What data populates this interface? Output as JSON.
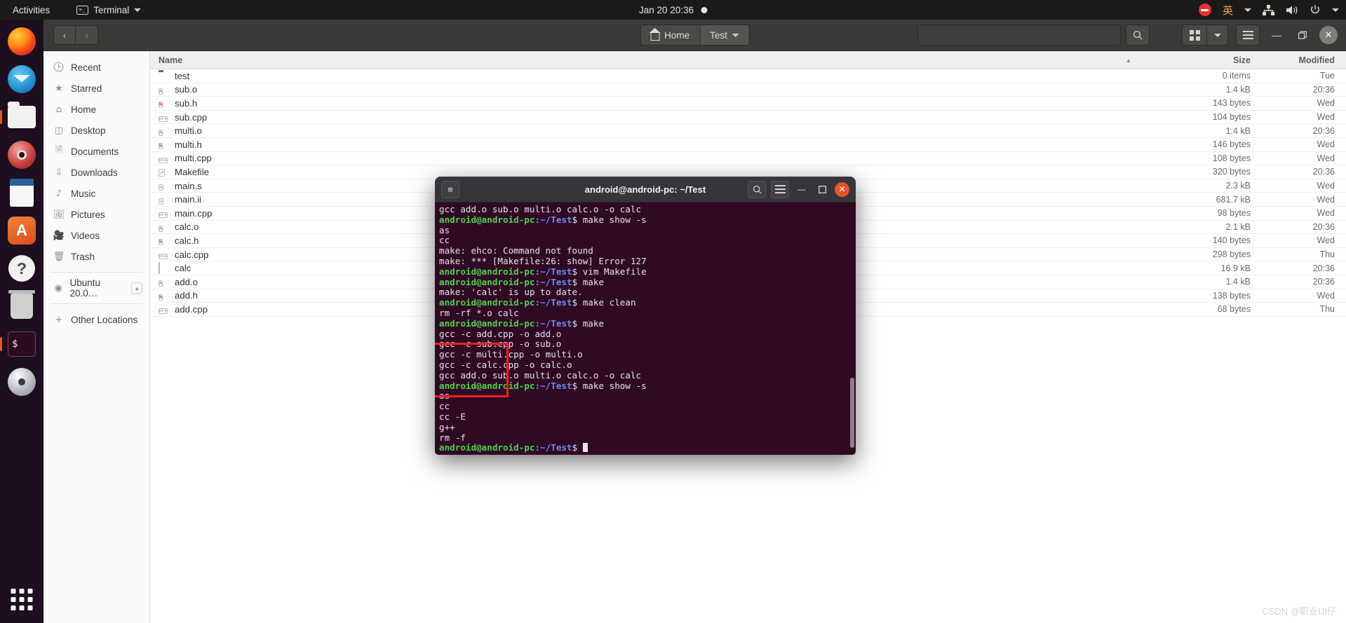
{
  "topbar": {
    "activities": "Activities",
    "app_menu": "Terminal",
    "app_icon": "terminal-icon",
    "clock": "Jan 20  20:36",
    "recording_dot": "recording-indicator",
    "tray": {
      "dnd_icon": "do-not-disturb-icon",
      "input_method": "英",
      "network_icon": "network-icon",
      "volume_icon": "volume-icon",
      "power_icon": "power-icon"
    }
  },
  "dock": {
    "items": [
      {
        "name": "firefox",
        "label": "Firefox"
      },
      {
        "name": "thunderbird",
        "label": "Thunderbird Mail"
      },
      {
        "name": "files",
        "label": "Files"
      },
      {
        "name": "rhythmbox",
        "label": "Rhythmbox"
      },
      {
        "name": "libreoffice-writer",
        "label": "LibreOffice Writer"
      },
      {
        "name": "ubuntu-software",
        "label": "Ubuntu Software"
      },
      {
        "name": "help",
        "label": "Help"
      },
      {
        "name": "trash",
        "label": "Trash"
      },
      {
        "name": "terminal",
        "label": "Terminal"
      },
      {
        "name": "dvd",
        "label": "Ubuntu 20.0 Disc"
      }
    ],
    "show_apps": "Show Applications"
  },
  "nautilus": {
    "nav": {
      "back": "‹",
      "forward": "›"
    },
    "breadcrumbs": [
      {
        "label": "Home",
        "icon": "home-icon"
      },
      {
        "label": "Test",
        "icon": "chevron-down-icon"
      }
    ],
    "search": {
      "placeholder": "",
      "value": "",
      "icon": "search-icon"
    },
    "view_toggle": {
      "icon": "grid-view-icon",
      "caret": "chevron-down-icon"
    },
    "menu_icon": "hamburger-menu-icon",
    "window_controls": {
      "minimize": "—",
      "maximize": "❐",
      "close": "✕"
    },
    "sidebar": [
      {
        "label": "Recent",
        "icon": "clock-icon"
      },
      {
        "label": "Starred",
        "icon": "star-icon"
      },
      {
        "label": "Home",
        "icon": "home-icon"
      },
      {
        "label": "Desktop",
        "icon": "desktop-icon"
      },
      {
        "label": "Documents",
        "icon": "documents-icon"
      },
      {
        "label": "Downloads",
        "icon": "downloads-icon"
      },
      {
        "label": "Music",
        "icon": "music-icon"
      },
      {
        "label": "Pictures",
        "icon": "pictures-icon"
      },
      {
        "label": "Videos",
        "icon": "videos-icon"
      },
      {
        "label": "Trash",
        "icon": "trash-icon"
      }
    ],
    "sidebar_devices": [
      {
        "label": "Ubuntu 20.0…",
        "icon": "disc-icon",
        "eject": "eject-icon"
      }
    ],
    "sidebar_other": {
      "label": "Other Locations",
      "icon": "plus-icon"
    },
    "columns": {
      "name": "Name",
      "size": "Size",
      "modified": "Modified",
      "sort_indicator": "▲"
    },
    "files": [
      {
        "name": "test",
        "icon": "folder",
        "size": "0 items",
        "modified": "Tue"
      },
      {
        "name": "sub.o",
        "icon": "obj",
        "size": "1.4 kB",
        "modified": "20:36"
      },
      {
        "name": "sub.h",
        "icon": "header",
        "size": "143 bytes",
        "modified": "Wed"
      },
      {
        "name": "sub.cpp",
        "icon": "cpp",
        "size": "104 bytes",
        "modified": "Wed"
      },
      {
        "name": "multi.o",
        "icon": "obj",
        "size": "1.4 kB",
        "modified": "20:36"
      },
      {
        "name": "multi.h",
        "icon": "header",
        "size": "146 bytes",
        "modified": "Wed"
      },
      {
        "name": "multi.cpp",
        "icon": "cpp",
        "size": "108 bytes",
        "modified": "Wed"
      },
      {
        "name": "Makefile",
        "icon": "makefile",
        "size": "320 bytes",
        "modified": "20:36"
      },
      {
        "name": "main.s",
        "icon": "text",
        "size": "2.3 kB",
        "modified": "Wed"
      },
      {
        "name": "main.ii",
        "icon": "text",
        "size": "681.7 kB",
        "modified": "Wed"
      },
      {
        "name": "main.cpp",
        "icon": "cpp",
        "size": "98 bytes",
        "modified": "Wed"
      },
      {
        "name": "calc.o",
        "icon": "obj",
        "size": "2.1 kB",
        "modified": "20:36"
      },
      {
        "name": "calc.h",
        "icon": "header",
        "size": "140 bytes",
        "modified": "Wed"
      },
      {
        "name": "calc.cpp",
        "icon": "cpp",
        "size": "298 bytes",
        "modified": "Thu"
      },
      {
        "name": "calc",
        "icon": "exec",
        "size": "16.9 kB",
        "modified": "20:36"
      },
      {
        "name": "add.o",
        "icon": "obj",
        "size": "1.4 kB",
        "modified": "20:36"
      },
      {
        "name": "add.h",
        "icon": "header",
        "size": "138 bytes",
        "modified": "Wed"
      },
      {
        "name": "add.cpp",
        "icon": "cpp",
        "size": "68 bytes",
        "modified": "Thu"
      }
    ]
  },
  "terminal": {
    "title": "android@android-pc: ~/Test",
    "new_tab_icon": "new-tab-icon",
    "search_icon": "search-icon",
    "menu_icon": "hamburger-menu-icon",
    "minimize": "—",
    "maximize": "❐",
    "close": "✕",
    "prompt_user": "android@android-pc",
    "prompt_path": ":~/Test",
    "prompt_sigil": "$ ",
    "lines": [
      {
        "type": "out",
        "text": "gcc add.o sub.o multi.o calc.o -o calc"
      },
      {
        "type": "cmd",
        "text": "make show -s"
      },
      {
        "type": "out",
        "text": "as"
      },
      {
        "type": "out",
        "text": "cc"
      },
      {
        "type": "out",
        "text": "make: ehco: Command not found"
      },
      {
        "type": "out",
        "text": "make: *** [Makefile:26: show] Error 127"
      },
      {
        "type": "cmd",
        "text": "vim Makefile"
      },
      {
        "type": "cmd",
        "text": "make"
      },
      {
        "type": "out",
        "text": "make: 'calc' is up to date."
      },
      {
        "type": "cmd",
        "text": "make clean"
      },
      {
        "type": "out",
        "text": "rm -rf *.o calc"
      },
      {
        "type": "cmd",
        "text": "make"
      },
      {
        "type": "out",
        "text": "gcc -c add.cpp -o add.o"
      },
      {
        "type": "out",
        "text": "gcc -c sub.cpp -o sub.o"
      },
      {
        "type": "out",
        "text": "gcc -c multi.cpp -o multi.o"
      },
      {
        "type": "out",
        "text": "gcc -c calc.cpp -o calc.o"
      },
      {
        "type": "out",
        "text": "gcc add.o sub.o multi.o calc.o -o calc"
      },
      {
        "type": "cmd",
        "text": "make show -s"
      },
      {
        "type": "out",
        "text": "as"
      },
      {
        "type": "out",
        "text": "cc"
      },
      {
        "type": "out",
        "text": "cc -E"
      },
      {
        "type": "out",
        "text": "g++"
      },
      {
        "type": "out",
        "text": "rm -f"
      },
      {
        "type": "prompt_cursor",
        "text": ""
      }
    ]
  },
  "annotation": {
    "highlight_color": "#ef2020",
    "name": "red-highlight-box"
  },
  "watermark": "CSDN @职业UI仔"
}
